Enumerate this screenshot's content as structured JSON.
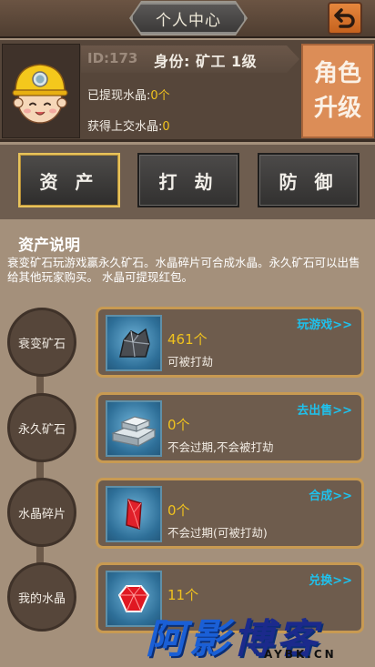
{
  "header": {
    "title": "个人中心",
    "back_icon": "back-arrow-icon"
  },
  "profile": {
    "id_label": "ID:173",
    "role_label": "身份: 矿工 1级",
    "withdrawn_label": "已提现水晶:",
    "withdrawn_value": "0个",
    "received_label": "获得上交水晶:",
    "received_value": "0",
    "upgrade_line1": "角色",
    "upgrade_line2": "升级",
    "avatar_icon": "miner-avatar-icon"
  },
  "tabs": [
    {
      "label": "资 产",
      "active": true
    },
    {
      "label": "打 劫",
      "active": false
    },
    {
      "label": "防 御",
      "active": false
    }
  ],
  "assets": {
    "title": "资产说明",
    "description": "衰变矿石玩游戏赢永久矿石。水晶碎片可合成水晶。永久矿石可以出售给其他玩家购买。 水晶可提现红包。",
    "items": [
      {
        "label": "衰变矿石",
        "count": "461个",
        "note": "可被打劫",
        "action": "玩游戏>>",
        "icon": "decaying-ore-icon"
      },
      {
        "label": "永久矿石",
        "count": "0个",
        "note": "不会过期,不会被打劫",
        "action": "去出售>>",
        "icon": "permanent-ore-icon"
      },
      {
        "label": "水晶碎片",
        "count": "0个",
        "note": "不会过期(可被打劫)",
        "action": "合成>>",
        "icon": "crystal-shard-icon"
      },
      {
        "label": "我的水晶",
        "count": "11个",
        "note": "",
        "action": "兑换>>",
        "icon": "crystal-gem-icon"
      }
    ]
  },
  "watermark": {
    "main_a": "阿",
    "main_b": "影",
    "main_c": "博客",
    "sub": "AYBK.CN"
  },
  "colors": {
    "accent_orange": "#dc8d57",
    "count_yellow": "#f0c21e",
    "action_cyan": "#1fc1ec",
    "active_tab_border": "#e8c35a"
  }
}
